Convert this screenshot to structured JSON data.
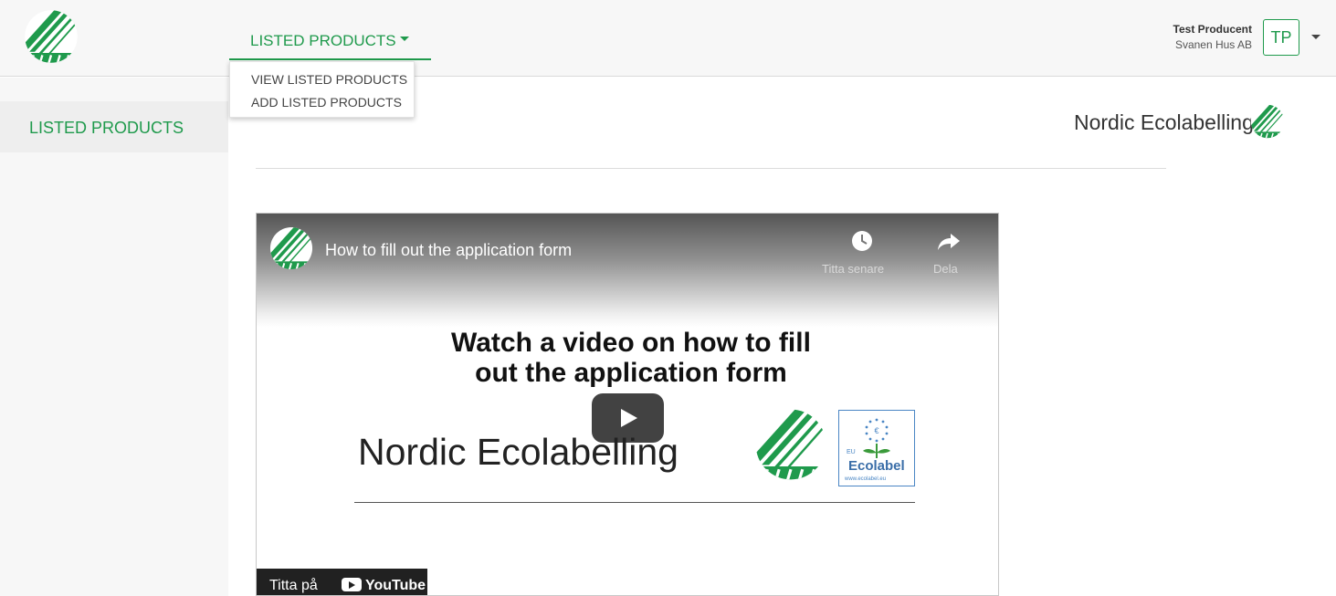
{
  "header": {
    "nav_tab_label": "LISTED PRODUCTS",
    "user_name": "Test Producent",
    "user_company": "Svanen Hus AB",
    "avatar_initials": "TP"
  },
  "dropdown": {
    "items": [
      "VIEW LISTED PRODUCTS",
      "ADD LISTED PRODUCTS"
    ]
  },
  "sidebar": {
    "items": [
      {
        "label": "LISTED PRODUCTS"
      }
    ]
  },
  "main": {
    "brand_text": "Nordic Ecolabelling"
  },
  "video": {
    "title": "How to fill out the application form",
    "watch_later_label": "Titta senare",
    "share_label": "Dela",
    "thumbnail_heading_line1": "Watch a video on how to fill",
    "thumbnail_heading_line2": "out the application form",
    "thumbnail_brand": "Nordic Ecolabelling",
    "eu_ecolabel_text": "Ecolabel",
    "eu_ecolabel_prefix": "EU",
    "eu_ecolabel_url": "www.ecolabel.eu",
    "watch_on_label": "Titta på",
    "youtube_label": "YouTube"
  },
  "colors": {
    "accent_green": "#1f9a4c",
    "topbar_bg": "#f7f7f7",
    "sidebar_active_bg": "#eeeeee"
  },
  "icons": {
    "logo": "swan-logo-icon",
    "nav_caret": "caret-down-icon",
    "watch_later": "clock-icon",
    "share": "share-arrow-icon",
    "play": "play-icon",
    "youtube": "youtube-icon"
  }
}
